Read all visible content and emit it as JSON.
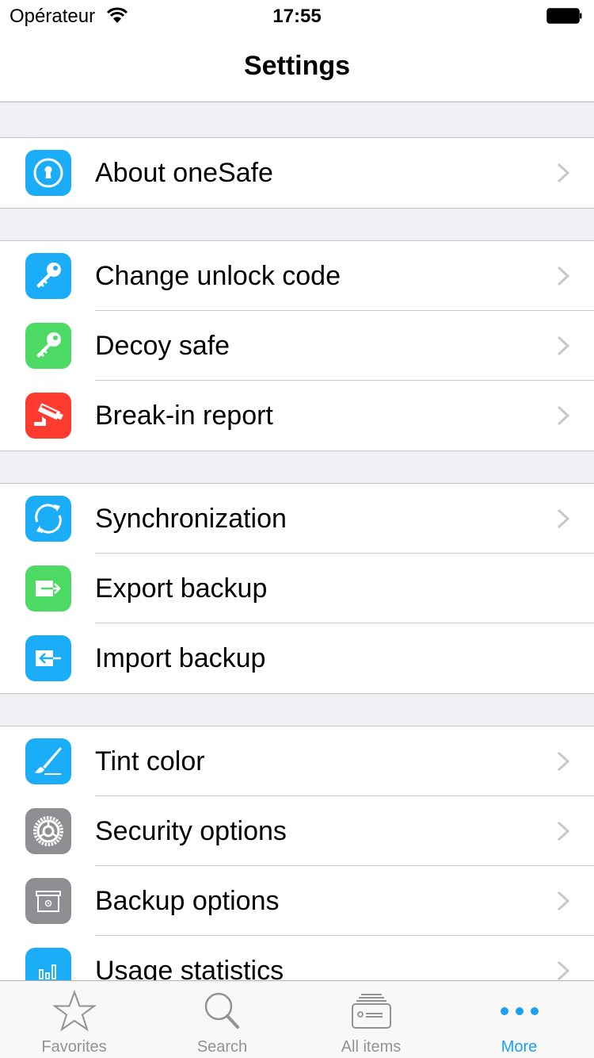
{
  "status_bar": {
    "carrier": "Opérateur",
    "time": "17:55",
    "wifi_icon": "wifi-icon",
    "battery_icon": "battery-icon"
  },
  "nav": {
    "title": "Settings"
  },
  "colors": {
    "blue": "#1badf8",
    "green": "#4cd964",
    "red": "#ff3b30",
    "gray": "#8e8e93",
    "tint": "#1aa1f0",
    "chevron": "#c7c7cc",
    "separator": "#c8c7cc",
    "background": "#efeff4"
  },
  "sections": [
    {
      "items": [
        {
          "label": "About oneSafe",
          "icon": "keyhole-icon",
          "color": "blue",
          "chevron": true
        }
      ]
    },
    {
      "items": [
        {
          "label": "Change unlock code",
          "icon": "key-icon",
          "color": "blue",
          "chevron": true
        },
        {
          "label": "Decoy safe",
          "icon": "key-icon",
          "color": "green",
          "chevron": true
        },
        {
          "label": "Break-in report",
          "icon": "security-camera-icon",
          "color": "red",
          "chevron": true
        }
      ]
    },
    {
      "items": [
        {
          "label": "Synchronization",
          "icon": "sync-icon",
          "color": "blue",
          "chevron": true
        },
        {
          "label": "Export backup",
          "icon": "export-icon",
          "color": "green",
          "chevron": false
        },
        {
          "label": "Import backup",
          "icon": "import-icon",
          "color": "blue",
          "chevron": false
        }
      ]
    },
    {
      "items": [
        {
          "label": "Tint color",
          "icon": "paintbrush-icon",
          "color": "blue",
          "chevron": true
        },
        {
          "label": "Security options",
          "icon": "gear-icon",
          "color": "gray",
          "chevron": true
        },
        {
          "label": "Backup options",
          "icon": "safe-box-icon",
          "color": "gray",
          "chevron": true
        },
        {
          "label": "Usage statistics",
          "icon": "bar-chart-icon",
          "color": "blue",
          "chevron": true
        }
      ]
    }
  ],
  "tabbar": {
    "tabs": [
      {
        "label": "Favorites",
        "icon": "star-icon",
        "active": false
      },
      {
        "label": "Search",
        "icon": "search-icon",
        "active": false
      },
      {
        "label": "All items",
        "icon": "cards-icon",
        "active": false
      },
      {
        "label": "More",
        "icon": "more-dots-icon",
        "active": true
      }
    ]
  }
}
